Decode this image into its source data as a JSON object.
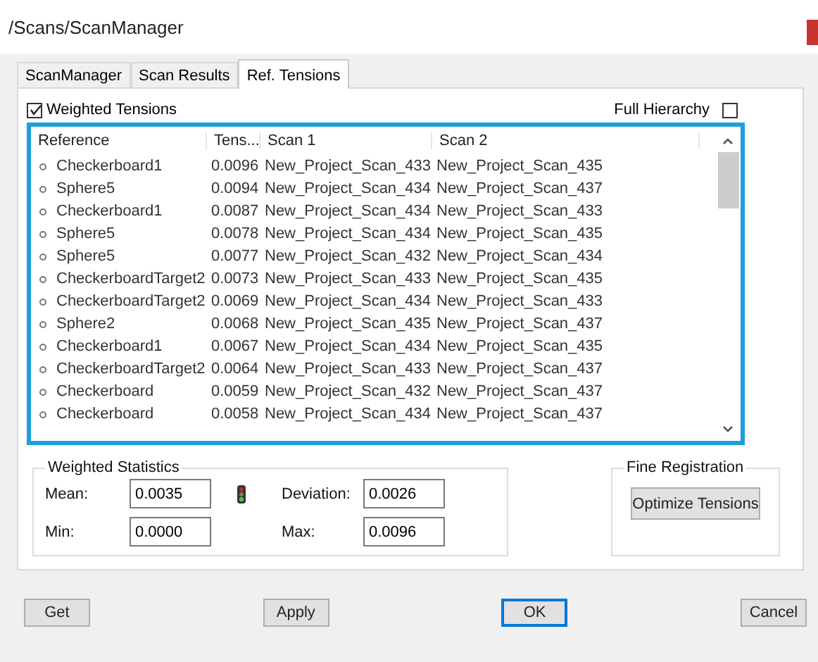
{
  "window": {
    "title": "/Scans/ScanManager"
  },
  "tabs": [
    {
      "label": "ScanManager",
      "selected": false
    },
    {
      "label": "Scan Results",
      "selected": false
    },
    {
      "label": "Ref. Tensions",
      "selected": true
    }
  ],
  "weighted_tensions": {
    "label": "Weighted Tensions",
    "checked": true
  },
  "full_hierarchy": {
    "label": "Full Hierarchy",
    "checked": false
  },
  "table": {
    "columns": [
      "Reference",
      "Tens...",
      "Scan 1",
      "Scan 2"
    ],
    "rows": [
      [
        "Checkerboard1",
        "0.0096",
        "New_Project_Scan_433",
        "New_Project_Scan_435"
      ],
      [
        "Sphere5",
        "0.0094",
        "New_Project_Scan_434",
        "New_Project_Scan_437"
      ],
      [
        "Checkerboard1",
        "0.0087",
        "New_Project_Scan_434",
        "New_Project_Scan_433"
      ],
      [
        "Sphere5",
        "0.0078",
        "New_Project_Scan_434",
        "New_Project_Scan_435"
      ],
      [
        "Sphere5",
        "0.0077",
        "New_Project_Scan_432",
        "New_Project_Scan_434"
      ],
      [
        "CheckerboardTarget2",
        "0.0073",
        "New_Project_Scan_433",
        "New_Project_Scan_435"
      ],
      [
        "CheckerboardTarget2",
        "0.0069",
        "New_Project_Scan_434",
        "New_Project_Scan_433"
      ],
      [
        "Sphere2",
        "0.0068",
        "New_Project_Scan_435",
        "New_Project_Scan_437"
      ],
      [
        "Checkerboard1",
        "0.0067",
        "New_Project_Scan_434",
        "New_Project_Scan_435"
      ],
      [
        "CheckerboardTarget2",
        "0.0064",
        "New_Project_Scan_433",
        "New_Project_Scan_437"
      ],
      [
        "Checkerboard",
        "0.0059",
        "New_Project_Scan_432",
        "New_Project_Scan_437"
      ],
      [
        "Checkerboard",
        "0.0058",
        "New_Project_Scan_434",
        "New_Project_Scan_437"
      ]
    ]
  },
  "weighted_statistics": {
    "title": "Weighted Statistics",
    "fields": [
      {
        "label": "Mean:",
        "value": "0.0035"
      },
      {
        "label": "Deviation:",
        "value": "0.0026"
      },
      {
        "label": "Min:",
        "value": "0.0000"
      },
      {
        "label": "Max:",
        "value": "0.0096"
      }
    ]
  },
  "fine_registration": {
    "title": "Fine Registration",
    "button": "Optimize Tensions"
  },
  "buttons": [
    {
      "label": "Get",
      "default": false
    },
    {
      "label": "Apply",
      "default": false
    },
    {
      "label": "OK",
      "default": true
    },
    {
      "label": "Cancel",
      "default": false
    }
  ]
}
